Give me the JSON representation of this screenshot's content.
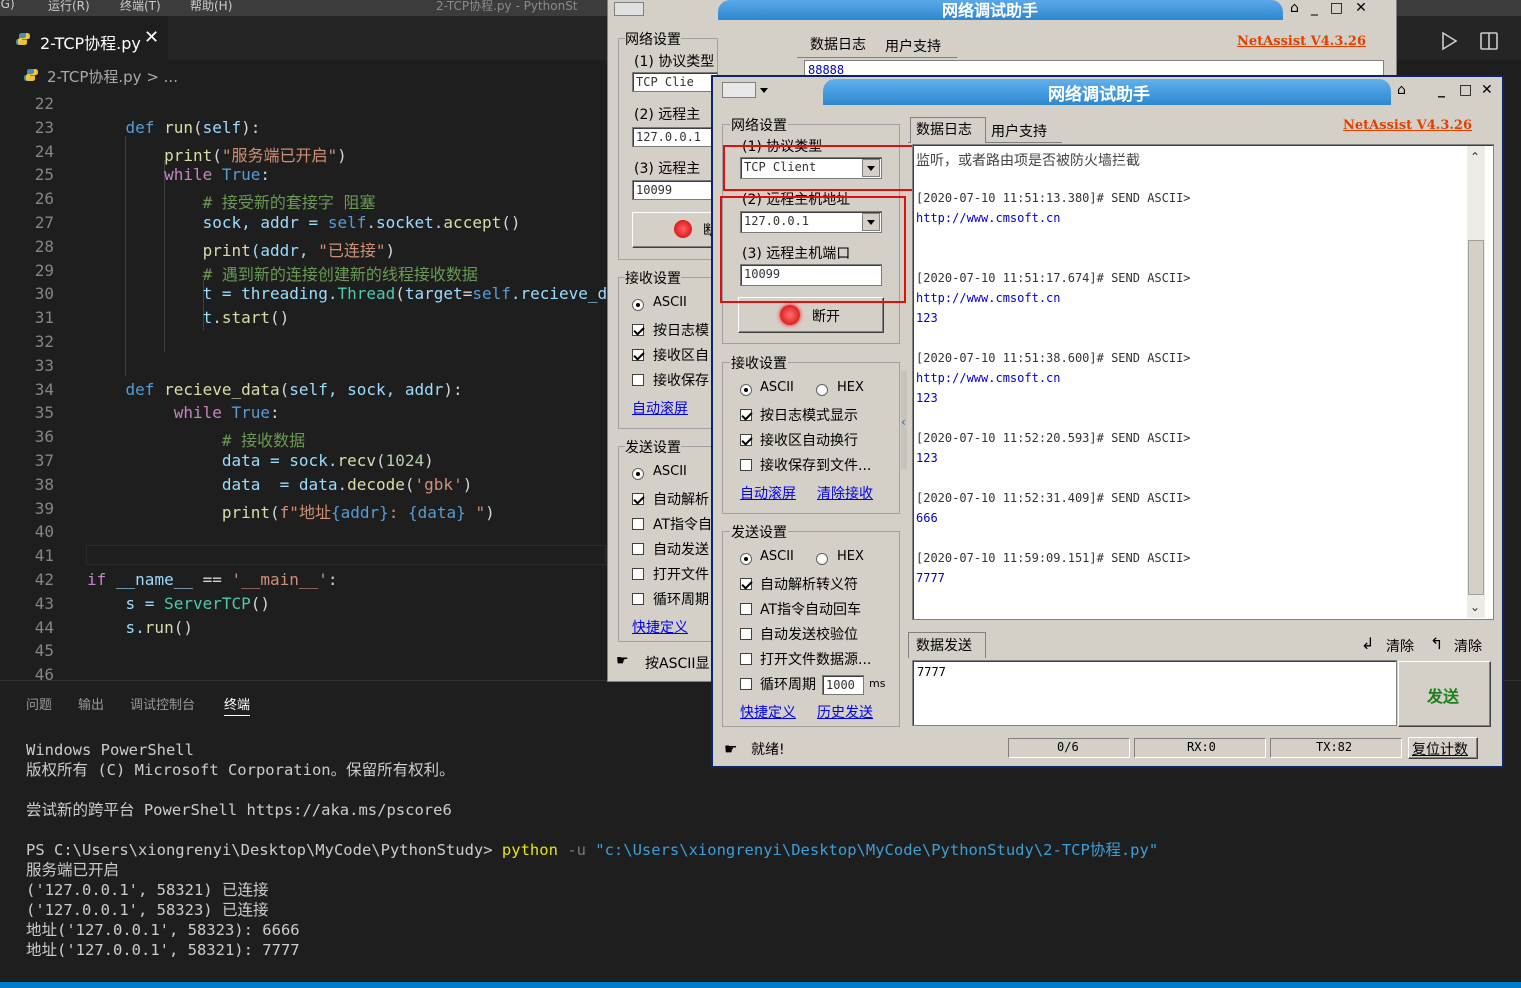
{
  "vscode": {
    "menu": [
      "(G)",
      "运行(R)",
      "终端(T)",
      "帮助(H)",
      "2-TCP协程.py - PythonSt"
    ],
    "tab_label": "2-TCP协程.py",
    "tab_close": "✕",
    "breadcrumb": "2-TCP协程.py > ...",
    "code_lines": [
      {
        "n": "22",
        "t": []
      },
      {
        "n": "23",
        "t": [
          [
            "    ",
            "p"
          ],
          [
            "def ",
            "k"
          ],
          [
            "run",
            "f"
          ],
          [
            "(",
            "p"
          ],
          [
            "self",
            "v"
          ],
          [
            "):",
            "p"
          ]
        ]
      },
      {
        "n": "24",
        "t": [
          [
            "        ",
            "p"
          ],
          [
            "print",
            "f"
          ],
          [
            "(",
            "p"
          ],
          [
            "\"服务端已开启\"",
            "s"
          ],
          [
            ")",
            "p"
          ]
        ]
      },
      {
        "n": "25",
        "t": [
          [
            "        ",
            "p"
          ],
          [
            "while ",
            "c"
          ],
          [
            "True",
            "k"
          ],
          [
            ":",
            "p"
          ]
        ]
      },
      {
        "n": "26",
        "t": [
          [
            "            ",
            "p"
          ],
          [
            "# 接受新的套接字 阻塞",
            "m"
          ]
        ]
      },
      {
        "n": "27",
        "t": [
          [
            "            ",
            "p"
          ],
          [
            "sock, addr = ",
            "v"
          ],
          [
            "self",
            "k"
          ],
          [
            ".socket.",
            "v"
          ],
          [
            "accept",
            "f"
          ],
          [
            "()",
            "p"
          ]
        ]
      },
      {
        "n": "28",
        "t": [
          [
            "            ",
            "p"
          ],
          [
            "print",
            "f"
          ],
          [
            "(addr, ",
            "v"
          ],
          [
            "\"已连接\"",
            "s"
          ],
          [
            ")",
            "p"
          ]
        ]
      },
      {
        "n": "29",
        "t": [
          [
            "            ",
            "p"
          ],
          [
            "# 遇到新的连接创建新的线程接收数据",
            "m"
          ]
        ]
      },
      {
        "n": "30",
        "t": [
          [
            "            ",
            "p"
          ],
          [
            "t = threading.",
            "v"
          ],
          [
            "Thread",
            "t"
          ],
          [
            "(",
            "p"
          ],
          [
            "target",
            "v"
          ],
          [
            "=",
            "p"
          ],
          [
            "self",
            "k"
          ],
          [
            ".recieve_d",
            "v"
          ]
        ]
      },
      {
        "n": "31",
        "t": [
          [
            "            ",
            "p"
          ],
          [
            "t.",
            "v"
          ],
          [
            "start",
            "f"
          ],
          [
            "()",
            "p"
          ]
        ]
      },
      {
        "n": "32",
        "t": []
      },
      {
        "n": "33",
        "t": []
      },
      {
        "n": "34",
        "t": [
          [
            "    ",
            "p"
          ],
          [
            "def ",
            "k"
          ],
          [
            "recieve_data",
            "f"
          ],
          [
            "(",
            "p"
          ],
          [
            "self, sock, addr",
            "v"
          ],
          [
            "):",
            "p"
          ]
        ]
      },
      {
        "n": "35",
        "t": [
          [
            "        ",
            "p"
          ],
          [
            " while ",
            "c"
          ],
          [
            "True",
            "k"
          ],
          [
            ":",
            "p"
          ]
        ]
      },
      {
        "n": "36",
        "t": [
          [
            "              ",
            "p"
          ],
          [
            "# 接收数据",
            "m"
          ]
        ]
      },
      {
        "n": "37",
        "t": [
          [
            "              ",
            "p"
          ],
          [
            "data = sock.",
            "v"
          ],
          [
            "recv",
            "f"
          ],
          [
            "(",
            "p"
          ],
          [
            "1024",
            "n"
          ],
          [
            ")",
            "p"
          ]
        ]
      },
      {
        "n": "38",
        "t": [
          [
            "              ",
            "p"
          ],
          [
            "data  = data.",
            "v"
          ],
          [
            "decode",
            "f"
          ],
          [
            "(",
            "p"
          ],
          [
            "'gbk'",
            "s"
          ],
          [
            ")",
            "p"
          ]
        ]
      },
      {
        "n": "39",
        "t": [
          [
            "              ",
            "p"
          ],
          [
            "print",
            "f"
          ],
          [
            "(",
            "p"
          ],
          [
            "f\"地址",
            "s"
          ],
          [
            "{addr}",
            "k"
          ],
          [
            ": ",
            "s"
          ],
          [
            "{data}",
            "k"
          ],
          [
            " \"",
            "s"
          ],
          [
            ")",
            "p"
          ]
        ]
      },
      {
        "n": "40",
        "t": []
      },
      {
        "n": "41",
        "t": []
      },
      {
        "n": "42",
        "t": [
          [
            "if ",
            "c"
          ],
          [
            "__name__",
            "v"
          ],
          [
            " == ",
            "p"
          ],
          [
            "'__main__'",
            "s"
          ],
          [
            ":",
            "p"
          ]
        ]
      },
      {
        "n": "43",
        "t": [
          [
            "    ",
            "p"
          ],
          [
            "s = ",
            "v"
          ],
          [
            "ServerTCP",
            "t"
          ],
          [
            "()",
            "p"
          ]
        ]
      },
      {
        "n": "44",
        "t": [
          [
            "    ",
            "p"
          ],
          [
            "s.",
            "v"
          ],
          [
            "run",
            "f"
          ],
          [
            "()",
            "p"
          ]
        ]
      },
      {
        "n": "45",
        "t": []
      },
      {
        "n": "46",
        "t": []
      }
    ],
    "panel_tabs": [
      "问题",
      "输出",
      "调试控制台",
      "终端"
    ],
    "terminal": [
      {
        "text": "Windows PowerShell"
      },
      {
        "text": "版权所有 (C) Microsoft Corporation。保留所有权利。"
      },
      {
        "text": ""
      },
      {
        "text": "尝试新的跨平台 PowerShell https://aka.ms/pscore6"
      },
      {
        "text": ""
      },
      {
        "prompt": "PS C:\\Users\\xiongrenyi\\Desktop\\MyCode\\PythonStudy> ",
        "cmd": "python",
        "flag": " -u ",
        "arg": "\"c:\\Users\\xiongrenyi\\Desktop\\MyCode\\PythonStudy\\2-TCP协程.py\""
      },
      {
        "text": "服务端已开启"
      },
      {
        "text": "('127.0.0.1', 58321) 已连接"
      },
      {
        "text": "('127.0.0.1', 58323) 已连接"
      },
      {
        "text": "地址('127.0.0.1', 58323): 6666"
      },
      {
        "text": "地址('127.0.0.1', 58321): 7777"
      }
    ]
  },
  "netassist_back": {
    "title": "网络调试助手",
    "net_settings": "网络设置",
    "protocol_label": "(1) 协议类型",
    "protocol_value": "TCP Clie",
    "host_label": "(2) 远程主",
    "host_value": "127.0.0.1",
    "port_label": "(3) 远程主",
    "port_value": "10099",
    "connect_short": "断",
    "recv_settings": "接收设置",
    "recv_items": [
      "ASCII",
      "按日志模",
      "接收区自",
      "接收保存"
    ],
    "auto_scroll": "自动滚屏",
    "send_settings": "发送设置",
    "send_items": [
      "ASCII",
      "自动解析",
      "AT指令自",
      "自动发送",
      "打开文件",
      "循环周期"
    ],
    "quick_def": "快捷定义",
    "status": "按ASCII显",
    "tab_log": "数据日志",
    "tab_support": "用户支持",
    "brand": "NetAssist V4.3.26",
    "log_peek": "88888"
  },
  "netassist": {
    "title": "网络调试助手",
    "brand": "NetAssist V4.3.26",
    "net_settings": "网络设置",
    "protocol_label": "(1) 协议类型",
    "protocol_value": "TCP Client",
    "host_label": "(2) 远程主机地址",
    "host_value": "127.0.0.1",
    "port_label": "(3) 远程主机端口",
    "port_value": "10099",
    "connect_btn": "断开",
    "recv_settings": "接收设置",
    "recv_ascii": "ASCII",
    "recv_hex": "HEX",
    "recv_checks": [
      {
        "label": "按日志模式显示",
        "checked": true
      },
      {
        "label": "接收区自动换行",
        "checked": true
      },
      {
        "label": "接收保存到文件...",
        "checked": false
      }
    ],
    "auto_scroll": "自动滚屏",
    "clear_recv": "清除接收",
    "send_settings": "发送设置",
    "send_ascii": "ASCII",
    "send_hex": "HEX",
    "send_checks": [
      {
        "label": "自动解析转义符",
        "checked": true
      },
      {
        "label": "AT指令自动回车",
        "checked": false
      },
      {
        "label": "自动发送校验位",
        "checked": false
      },
      {
        "label": "打开文件数据源...",
        "checked": false
      }
    ],
    "cycle_label": "循环周期",
    "cycle_value": "1000",
    "cycle_unit": "ms",
    "quick_def": "快捷定义",
    "history": "历史发送",
    "tab_log": "数据日志",
    "tab_support": "用户支持",
    "log_first": "监听，或者路由项是否被防火墙拦截",
    "log_entries": [
      {
        "header": "[2020-07-10 11:51:13.380]# SEND ASCII>",
        "lines": [
          "http://www.cmsoft.cn"
        ]
      },
      {
        "header": "[2020-07-10 11:51:17.674]# SEND ASCII>",
        "lines": [
          "http://www.cmsoft.cn",
          "123"
        ]
      },
      {
        "header": "[2020-07-10 11:51:38.600]# SEND ASCII>",
        "lines": [
          "http://www.cmsoft.cn",
          "123"
        ]
      },
      {
        "header": "[2020-07-10 11:52:20.593]# SEND ASCII>",
        "lines": [
          "123"
        ]
      },
      {
        "header": "[2020-07-10 11:52:31.409]# SEND ASCII>",
        "lines": [
          "666"
        ]
      },
      {
        "header": "[2020-07-10 11:59:09.151]# SEND ASCII>",
        "lines": [
          "7777"
        ]
      }
    ],
    "send_label": "数据发送",
    "clear1": "清除",
    "clear2": "清除",
    "send_text": "7777",
    "send_btn": "发送",
    "status_ready": "就绪!",
    "status_count": "0/6",
    "status_rx": "RX:0",
    "status_tx": "TX:82",
    "reset_count": "复位计数"
  },
  "colors": {
    "keyword": "#569cd6",
    "control": "#c586c0",
    "function": "#dcdcaa",
    "string": "#ce9178",
    "comment": "#6a9955",
    "variable": "#9cdcfe",
    "type": "#4ec9b0",
    "number": "#b5cea8",
    "title_bar": "#2c88d0",
    "link": "#0000ee",
    "brand": "#e04000",
    "log_blue": "#0000cc",
    "highlight": "#e01010"
  }
}
